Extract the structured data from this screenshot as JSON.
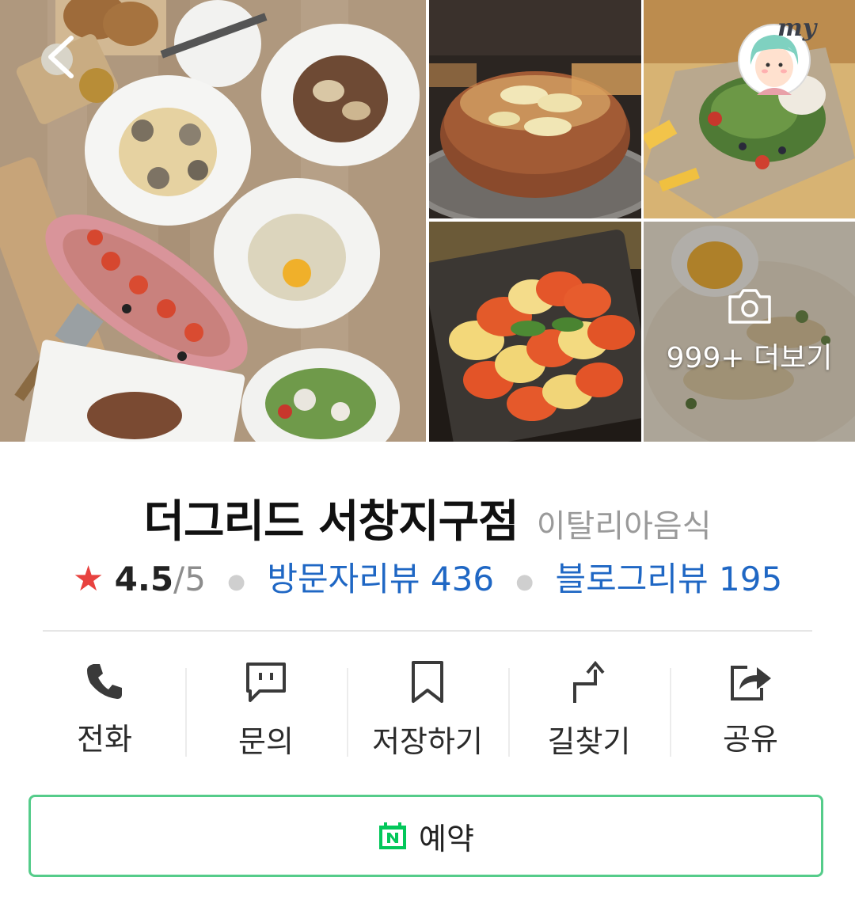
{
  "header": {
    "back_icon": "chevron-left-icon",
    "my_badge": "my"
  },
  "gallery": {
    "more_label": "999+ 더보기",
    "more_icon": "camera-icon"
  },
  "place": {
    "name": "더그리드 서창지구점",
    "category": "이탈리아음식",
    "rating": "4.5",
    "rating_max": "/5",
    "star_icon": "star-icon",
    "star_color": "#e8423f",
    "visitor_reviews": "방문자리뷰 436",
    "blog_reviews": "블로그리뷰 195",
    "link_color": "#1f67c4"
  },
  "actions": [
    {
      "label": "전화",
      "icon": "phone-icon"
    },
    {
      "label": "문의",
      "icon": "chat-icon"
    },
    {
      "label": "저장하기",
      "icon": "bookmark-icon"
    },
    {
      "label": "길찾기",
      "icon": "directions-icon"
    },
    {
      "label": "공유",
      "icon": "share-icon"
    }
  ],
  "reserve": {
    "label": "예약",
    "icon": "naver-booking-icon",
    "border_color": "#55cc8a"
  }
}
